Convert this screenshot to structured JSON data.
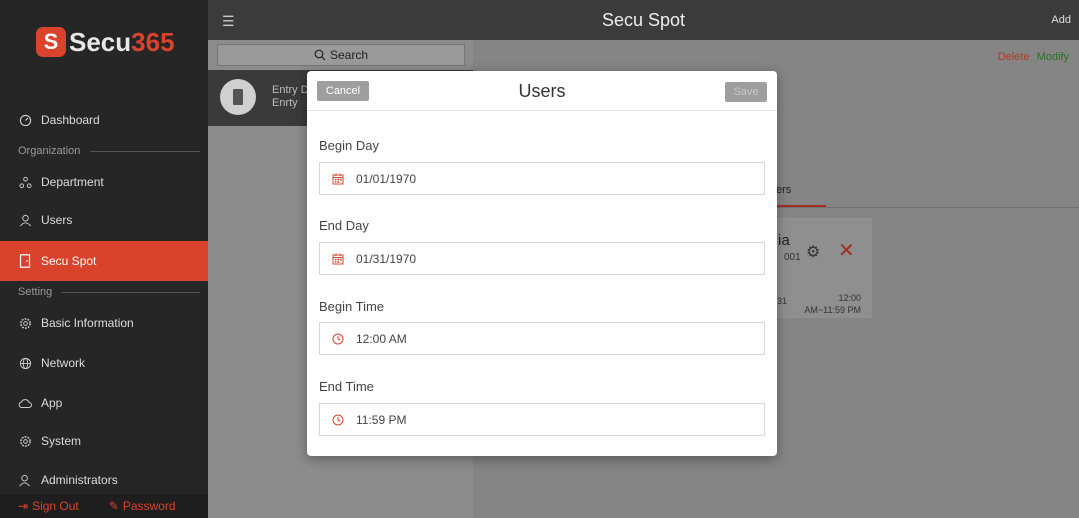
{
  "brand": {
    "badge": "S",
    "name_part1": "Secu",
    "name_part2": "365",
    "accent": "#d9432c"
  },
  "topbar": {
    "menu_icon": "hamburger-icon",
    "title": "Secu Spot",
    "add_label": "Add"
  },
  "sidebar": {
    "items": [
      {
        "label": "Dashboard",
        "icon": "dashboard-icon"
      },
      {
        "label": "Department",
        "icon": "department-icon"
      },
      {
        "label": "Users",
        "icon": "user-icon"
      },
      {
        "label": "Secu Spot",
        "icon": "door-icon",
        "active": true
      },
      {
        "label": "Basic Information",
        "icon": "gear-icon"
      },
      {
        "label": "Network",
        "icon": "globe-icon"
      },
      {
        "label": "App",
        "icon": "cloud-icon"
      },
      {
        "label": "System",
        "icon": "gear-icon"
      },
      {
        "label": "Administrators",
        "icon": "admin-icon"
      }
    ],
    "sections": {
      "organization": "Organization",
      "setting": "Setting"
    },
    "bottom": {
      "sign_out": "Sign Out",
      "password": "Password"
    }
  },
  "list": {
    "search_label": "Search",
    "spot": {
      "line1": "Entry D",
      "line2": "Enrty"
    }
  },
  "detail": {
    "delete_label": "Delete",
    "modify_label": "Modify",
    "tab_label": "ers",
    "card": {
      "name": "ia",
      "id": "001",
      "date": "31",
      "time_range": "12:00 AM~11:59 PM"
    }
  },
  "modal": {
    "title": "Users",
    "cancel_label": "Cancel",
    "save_label": "Save",
    "fields": {
      "begin_day": {
        "label": "Begin Day",
        "value": "01/01/1970",
        "icon": "calendar-icon"
      },
      "end_day": {
        "label": "End Day",
        "value": "01/31/1970",
        "icon": "calendar-icon"
      },
      "begin_time": {
        "label": "Begin Time",
        "value": "12:00 AM",
        "icon": "clock-icon"
      },
      "end_time": {
        "label": "End Time",
        "value": "11:59 PM",
        "icon": "clock-icon"
      }
    }
  }
}
